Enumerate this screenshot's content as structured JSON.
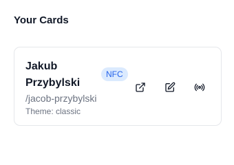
{
  "section": {
    "title": "Your Cards"
  },
  "card": {
    "name": "Jakub Przybylski",
    "badge": "NFC",
    "slug": "/jacob-przybylski",
    "theme": "Theme: classic",
    "actions": [
      {
        "icon": "external-link-icon"
      },
      {
        "icon": "edit-icon"
      },
      {
        "icon": "nfc-broadcast-icon"
      }
    ]
  }
}
